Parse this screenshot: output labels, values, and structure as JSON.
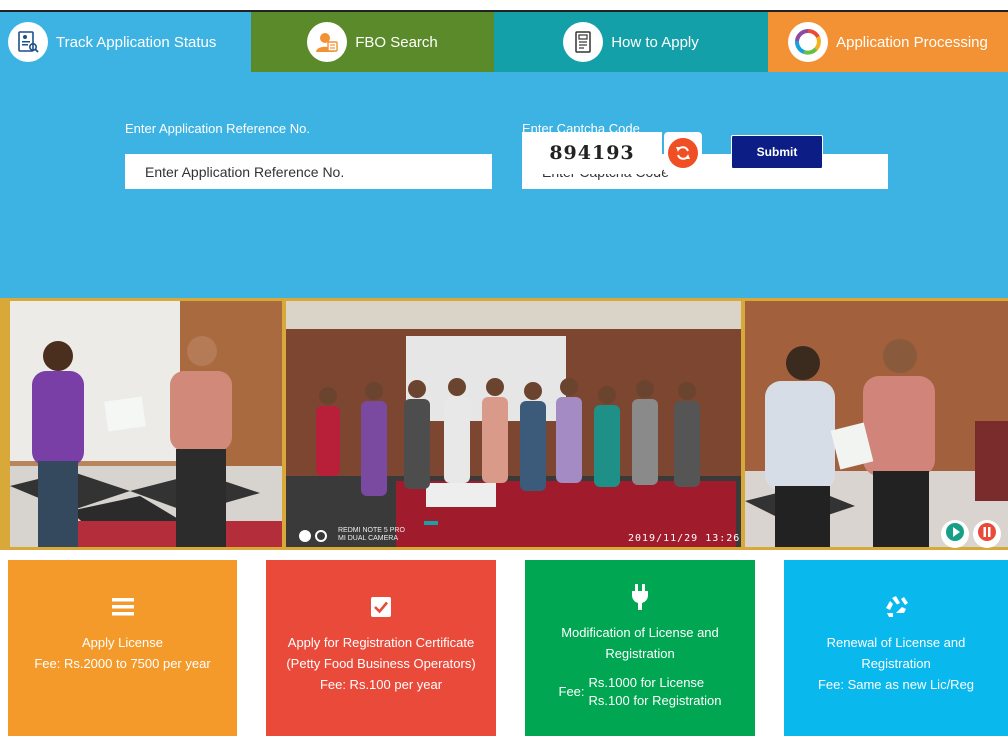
{
  "tabs": [
    {
      "label": "Track Application Status",
      "icon": "track-status-icon"
    },
    {
      "label": "FBO Search",
      "icon": "user-search-icon"
    },
    {
      "label": "How to Apply",
      "icon": "document-icon"
    },
    {
      "label": "Application Processing",
      "icon": "processing-ring-icon"
    }
  ],
  "form": {
    "ref_label": "Enter Application Reference No.",
    "ref_placeholder": "Enter Application Reference No.",
    "captcha_label": "Enter Captcha Code",
    "captcha_placeholder": "Enter Captcha Code",
    "captcha_value": "894193",
    "submit_label": "Submit"
  },
  "slider": {
    "timestamp": "2019/11/29  13:26",
    "watermark_line1": "REDMI NOTE 5 PRO",
    "watermark_line2": "MI DUAL CAMERA"
  },
  "cards": [
    {
      "icon": "list-icon",
      "title": "Apply License",
      "fee": "Fee: Rs.2000 to 7500 per year"
    },
    {
      "icon": "checkbox-icon",
      "title": "Apply for Registration Certificate",
      "subtitle": "(Petty Food Business Operators)",
      "fee": "Fee: Rs.100 per year"
    },
    {
      "icon": "plug-icon",
      "title": "Modification of License and",
      "title2": "Registration",
      "fee_label": "Fee:",
      "fee_line1": "Rs.1000 for License",
      "fee_line2": "Rs.100 for Registration"
    },
    {
      "icon": "recycle-icon",
      "title": "Renewal of License and",
      "title2": "Registration",
      "fee": "Fee: Same as new Lic/Reg"
    }
  ],
  "colors": {
    "tab_track": "#3db3e3",
    "tab_fbo": "#5b8a2b",
    "tab_how": "#13a0a8",
    "tab_processing": "#f29234",
    "card_apply": "#f39a2b",
    "card_registration": "#e94a3a",
    "card_modification": "#00a651",
    "card_renewal": "#09b8ec",
    "submit": "#0c1e86"
  }
}
